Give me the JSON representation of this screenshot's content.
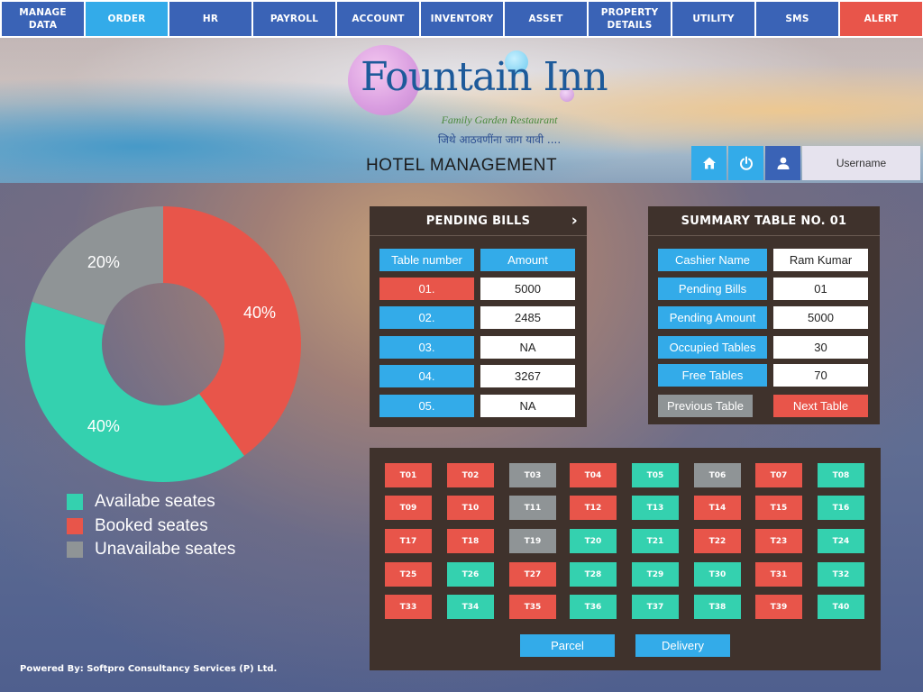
{
  "nav": [
    {
      "label": "MANAGE DATA",
      "style": "normal"
    },
    {
      "label": "ORDER",
      "style": "active"
    },
    {
      "label": "HR",
      "style": "normal"
    },
    {
      "label": "PAYROLL",
      "style": "normal"
    },
    {
      "label": "ACCOUNT",
      "style": "normal"
    },
    {
      "label": "INVENTORY",
      "style": "normal"
    },
    {
      "label": "ASSET",
      "style": "normal"
    },
    {
      "label": "PROPERTY DETAILS",
      "style": "normal"
    },
    {
      "label": "UTILITY",
      "style": "normal"
    },
    {
      "label": "SMS",
      "style": "normal"
    },
    {
      "label": "ALERT",
      "style": "alert"
    }
  ],
  "banner": {
    "logo_title": "Fountain Inn",
    "tagline": "Family Garden Restaurant",
    "tagline_marathi": "जिथे आठवणींना जाग यावी ....",
    "title": "HOTEL MANAGEMENT",
    "icons": [
      "home-icon",
      "power-icon",
      "user-icon"
    ],
    "username": "Username"
  },
  "colors": {
    "nav_blue": "#3a63b6",
    "accent_blue": "#33abe9",
    "available": "#34d1af",
    "booked": "#e8554a",
    "unavailable": "#8f9496",
    "panel": "#3f322c"
  },
  "chart_data": {
    "type": "pie",
    "variant": "donut",
    "slices": [
      {
        "label": "Booked seates",
        "value": 40,
        "display": "40%",
        "color": "#e8554a"
      },
      {
        "label": "Availabe seates",
        "value": 40,
        "display": "40%",
        "color": "#34d1af"
      },
      {
        "label": "Unavailabe seates",
        "value": 20,
        "display": "20%",
        "color": "#8f9496"
      }
    ],
    "legend": [
      {
        "label": "Availabe seates",
        "color": "#34d1af"
      },
      {
        "label": "Booked seates",
        "color": "#e8554a"
      },
      {
        "label": "Unavailabe seates",
        "color": "#8f9496"
      }
    ],
    "legend_position": "bottom"
  },
  "pending_bills": {
    "title": "PENDING BILLS",
    "columns": [
      "Table number",
      "Amount"
    ],
    "rows": [
      {
        "table": "01.",
        "amount": "5000"
      },
      {
        "table": "02.",
        "amount": "2485"
      },
      {
        "table": "03.",
        "amount": "NA"
      },
      {
        "table": "04.",
        "amount": "3267"
      },
      {
        "table": "05.",
        "amount": "NA"
      }
    ]
  },
  "summary": {
    "title": "SUMMARY TABLE NO. 01",
    "rows": [
      {
        "label": "Cashier Name",
        "value": "Ram Kumar"
      },
      {
        "label": "Pending Bills",
        "value": "01"
      },
      {
        "label": "Pending Amount",
        "value": "5000"
      },
      {
        "label": "Occupied Tables",
        "value": "30"
      },
      {
        "label": "Free Tables",
        "value": "70"
      }
    ],
    "prev_label": "Previous Table",
    "next_label": "Next Table"
  },
  "tables": [
    {
      "id": "T01",
      "status": "booked"
    },
    {
      "id": "T02",
      "status": "booked"
    },
    {
      "id": "T03",
      "status": "unavailable"
    },
    {
      "id": "T04",
      "status": "booked"
    },
    {
      "id": "T05",
      "status": "available"
    },
    {
      "id": "T06",
      "status": "unavailable"
    },
    {
      "id": "T07",
      "status": "booked"
    },
    {
      "id": "T08",
      "status": "available"
    },
    {
      "id": "T09",
      "status": "booked"
    },
    {
      "id": "T10",
      "status": "booked"
    },
    {
      "id": "T11",
      "status": "unavailable"
    },
    {
      "id": "T12",
      "status": "booked"
    },
    {
      "id": "T13",
      "status": "available"
    },
    {
      "id": "T14",
      "status": "booked"
    },
    {
      "id": "T15",
      "status": "booked"
    },
    {
      "id": "T16",
      "status": "available"
    },
    {
      "id": "T17",
      "status": "booked"
    },
    {
      "id": "T18",
      "status": "booked"
    },
    {
      "id": "T19",
      "status": "unavailable"
    },
    {
      "id": "T20",
      "status": "available"
    },
    {
      "id": "T21",
      "status": "available"
    },
    {
      "id": "T22",
      "status": "booked"
    },
    {
      "id": "T23",
      "status": "booked"
    },
    {
      "id": "T24",
      "status": "available"
    },
    {
      "id": "T25",
      "status": "booked"
    },
    {
      "id": "T26",
      "status": "available"
    },
    {
      "id": "T27",
      "status": "booked"
    },
    {
      "id": "T28",
      "status": "available"
    },
    {
      "id": "T29",
      "status": "available"
    },
    {
      "id": "T30",
      "status": "available"
    },
    {
      "id": "T31",
      "status": "booked"
    },
    {
      "id": "T32",
      "status": "available"
    },
    {
      "id": "T33",
      "status": "booked"
    },
    {
      "id": "T34",
      "status": "available"
    },
    {
      "id": "T35",
      "status": "booked"
    },
    {
      "id": "T36",
      "status": "available"
    },
    {
      "id": "T37",
      "status": "available"
    },
    {
      "id": "T38",
      "status": "available"
    },
    {
      "id": "T39",
      "status": "booked"
    },
    {
      "id": "T40",
      "status": "available"
    }
  ],
  "actions": {
    "parcel": "Parcel",
    "delivery": "Delivery"
  },
  "footer": {
    "powered_by": "Powered By: Softpro Consultancy Services (P) Ltd."
  }
}
